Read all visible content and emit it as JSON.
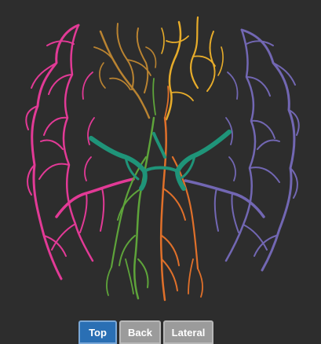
{
  "viewer": {
    "background": "#2d2d2d",
    "regions": [
      {
        "name": "left-hemisphere",
        "color": "#e23a96"
      },
      {
        "name": "left-anterior",
        "color": "#b98331"
      },
      {
        "name": "right-anterior",
        "color": "#e7ac2a"
      },
      {
        "name": "right-hemisphere",
        "color": "#7267b3"
      },
      {
        "name": "left-posterior",
        "color": "#5ea43a"
      },
      {
        "name": "right-posterior",
        "color": "#e0702a"
      },
      {
        "name": "central-circle",
        "color": "#1f9479"
      }
    ]
  },
  "view_buttons": {
    "top": "Top",
    "back": "Back",
    "lateral": "Lateral",
    "active": "Top"
  }
}
